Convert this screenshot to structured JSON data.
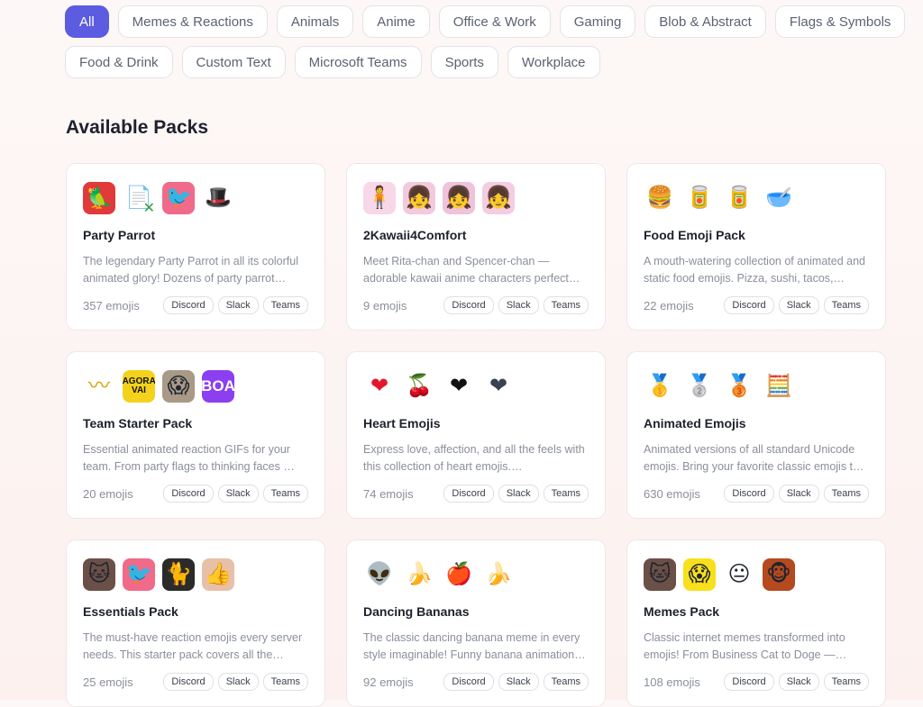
{
  "filters": {
    "row1": [
      "All",
      "Memes & Reactions",
      "Animals",
      "Anime",
      "Office & Work",
      "Gaming",
      "Blob & Abstract",
      "Flags & Symbols"
    ],
    "row2": [
      "Food & Drink",
      "Custom Text",
      "Microsoft Teams",
      "Sports",
      "Workplace"
    ],
    "active": "All",
    "active_color": "#5b5ce0"
  },
  "section_title": "Available Packs",
  "platform_tags": [
    "Discord",
    "Slack",
    "Teams"
  ],
  "packs": [
    {
      "title": "Party Parrot",
      "description": "The legendary Party Parrot in all its colorful animated glory! Dozens of party parrot…",
      "count": "357 emojis",
      "icons": [
        {
          "name": "parrot-slack-icon",
          "glyph": "🦜",
          "bg": "#e03a3a"
        },
        {
          "name": "parrot-x-icon",
          "glyph": "📄",
          "bg": "#ffffff",
          "mark": "✕",
          "markColor": "#2ea043"
        },
        {
          "name": "pink-parrot-icon",
          "glyph": "🐦",
          "bg": "#f06a8a"
        },
        {
          "name": "gentleman-parrot-icon",
          "glyph": "🎩",
          "bg": "#ffffff"
        }
      ]
    },
    {
      "title": "2Kawaii4Comfort",
      "description": "Meet Rita-chan and Spencer-chan — adorable kawaii anime characters perfect…",
      "count": "9 emojis",
      "icons": [
        {
          "name": "anime-girl-standing-icon",
          "glyph": "🧍",
          "bg": "#f7d7e8"
        },
        {
          "name": "anime-girl-face-icon",
          "glyph": "👧",
          "bg": "#f3c9dd"
        },
        {
          "name": "anime-girl-face-2-icon",
          "glyph": "👧",
          "bg": "#efc3dc"
        },
        {
          "name": "anime-girl-face-3-icon",
          "glyph": "👧",
          "bg": "#f4cde2"
        }
      ]
    },
    {
      "title": "Food Emoji Pack",
      "description": "A mouth-watering collection of animated and static food emojis. Pizza, sushi, tacos,…",
      "count": "22 emojis",
      "icons": [
        {
          "name": "burger-icon",
          "glyph": "🍔",
          "bg": "#ffffff"
        },
        {
          "name": "cola-can-icon",
          "glyph": "🥫",
          "bg": "#ffffff"
        },
        {
          "name": "cola-zero-can-icon",
          "glyph": "🥫",
          "bg": "#ffffff"
        },
        {
          "name": "pet-bowl-icon",
          "glyph": "🥣",
          "bg": "#ffffff"
        }
      ]
    },
    {
      "title": "Team Starter Pack",
      "description": "Essential animated reaction GIFs for your team. From party flags to thinking faces …",
      "count": "20 emojis",
      "icons": [
        {
          "name": "banner-flag-icon",
          "glyph": "〰",
          "bg": "#ffffff",
          "color": "#d6a400"
        },
        {
          "name": "agora-vai-icon",
          "text": "AGORA VAI",
          "bg": "#f4d21c",
          "color": "#111111"
        },
        {
          "name": "face-photo-icon",
          "glyph": "😱",
          "bg": "#a89a86"
        },
        {
          "name": "boa-text-icon",
          "text": "BOA",
          "bg": "#8b3ff0",
          "color": "#ffffff"
        }
      ]
    },
    {
      "title": "Heart Emojis",
      "description": "Express love, affection, and all the feels with this collection of heart emojis.…",
      "count": "74 emojis",
      "icons": [
        {
          "name": "red-heart-icon",
          "glyph": "❤",
          "bg": "#ffffff",
          "color": "#e3172b"
        },
        {
          "name": "cherries-icon",
          "glyph": "🍒",
          "bg": "#ffffff"
        },
        {
          "name": "black-heart-icon",
          "glyph": "❤",
          "bg": "#ffffff",
          "color": "#111111"
        },
        {
          "name": "dark-gem-heart-icon",
          "glyph": "❤",
          "bg": "#ffffff",
          "color": "#3a4252"
        }
      ]
    },
    {
      "title": "Animated Emojis",
      "description": "Animated versions of all standard Unicode emojis. Bring your favorite classic emojis t…",
      "count": "630 emojis",
      "icons": [
        {
          "name": "gold-medal-icon",
          "glyph": "🥇",
          "bg": "#ffffff"
        },
        {
          "name": "silver-medal-icon",
          "glyph": "🥈",
          "bg": "#ffffff"
        },
        {
          "name": "bronze-medal-icon",
          "glyph": "🥉",
          "bg": "#ffffff"
        },
        {
          "name": "abacus-icon",
          "glyph": "🧮",
          "bg": "#ffffff"
        }
      ]
    },
    {
      "title": "Essentials Pack",
      "description": "The must-have reaction emojis every server needs. This starter pack covers all the…",
      "count": "25 emojis",
      "icons": [
        {
          "name": "cat-face-icon",
          "glyph": "🐱",
          "bg": "#6b5048"
        },
        {
          "name": "pink-parrot-icon",
          "glyph": "🐦",
          "bg": "#f06a8a"
        },
        {
          "name": "table-cat-icon",
          "glyph": "🐈",
          "bg": "#2b2b2b"
        },
        {
          "name": "thumb-icon",
          "glyph": "👍",
          "bg": "#e8c0a8"
        }
      ]
    },
    {
      "title": "Dancing Bananas",
      "description": "The classic dancing banana meme in every style imaginable! Funny banana animation…",
      "count": "92 emojis",
      "icons": [
        {
          "name": "alien-dancer-icon",
          "glyph": "👽",
          "bg": "#ffffff"
        },
        {
          "name": "banana-dancer-icon",
          "glyph": "🍌",
          "bg": "#ffffff"
        },
        {
          "name": "apple-dancer-icon",
          "glyph": "🍎",
          "bg": "#ffffff"
        },
        {
          "name": "banana-dancer-2-icon",
          "glyph": "🍌",
          "bg": "#ffffff"
        }
      ]
    },
    {
      "title": "Memes Pack",
      "description": "Classic internet memes transformed into emojis! From Business Cat to Doge —…",
      "count": "108 emojis",
      "icons": [
        {
          "name": "cat-face-icon",
          "glyph": "🐱",
          "bg": "#6b5048"
        },
        {
          "name": "all-the-things-icon",
          "glyph": "😱",
          "bg": "#f8e01c"
        },
        {
          "name": "rage-face-icon",
          "glyph": "😐",
          "bg": "#ffffff"
        },
        {
          "name": "monkey-puppet-icon",
          "glyph": "🐵",
          "bg": "#b54a1e"
        }
      ]
    }
  ]
}
